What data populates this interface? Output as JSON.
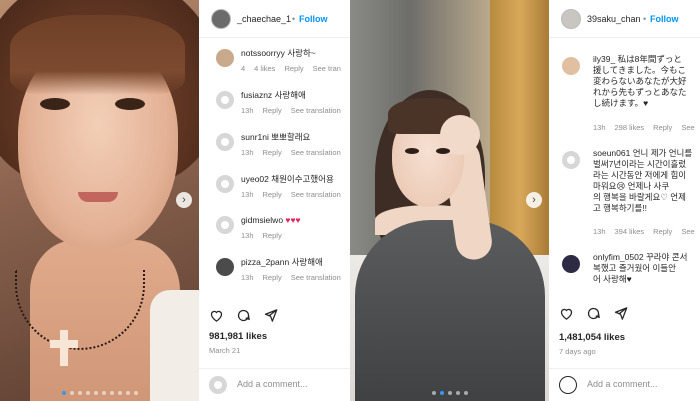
{
  "post1": {
    "header": {
      "username": "_chaechae_1",
      "separator": "•",
      "follow_label": "Follow"
    },
    "comments": [
      {
        "username": "notssoorryy",
        "text": "사랑하~",
        "time": "4",
        "likes": "4 likes",
        "reply": "Reply",
        "translation": "See tran"
      },
      {
        "username": "fusiaznz",
        "text": "사랑해애",
        "time": "13h",
        "reply": "Reply",
        "translation": "See translation"
      },
      {
        "username": "sunr1ni",
        "text": "뽀뽀할래요",
        "time": "13h",
        "reply": "Reply",
        "translation": "See translation"
      },
      {
        "username": "uyeo02",
        "text": "채원이수고했어용",
        "time": "13h",
        "reply": "Reply",
        "translation": "See translation"
      },
      {
        "username": "gidmsielwo",
        "text": "♥♥♥",
        "time": "13h",
        "reply": "Reply"
      },
      {
        "username": "pizza_2pann",
        "text": "사랑해애",
        "time": "13h",
        "reply": "Reply",
        "translation": "See translation"
      }
    ],
    "likes_text": "981,981 likes",
    "date": "March 21",
    "add_comment_placeholder": "Add a comment..."
  },
  "post2": {
    "header": {
      "username": "39saku_chan",
      "separator": "•",
      "follow_label": "Follow"
    },
    "comments": [
      {
        "username": "ily39_",
        "lines": [
          "私は8年間ずっと",
          "援してきました。今もこ",
          "変わらないあなたが大好",
          "れから先もずっとあなた",
          "し続けます。♥"
        ],
        "time": "13h",
        "likes": "298 likes",
        "reply": "Reply",
        "translation": "See"
      },
      {
        "username": "soeun061",
        "lines": [
          "언니 제가 언니를",
          "벌써7년이라는 시간이흘렀",
          "라는 시간동안 저에게 힘이",
          "마워요😢 언제나 사쿠",
          "의 행복을 바랄게요♡ 언제",
          "고 행복하기를!!"
        ],
        "time": "13h",
        "likes": "394 likes",
        "reply": "Reply",
        "translation": "See"
      },
      {
        "username": "onlyfim_0502",
        "lines": [
          "꾸라야 콘서",
          "복했고 즐거웠어 이들안",
          "어 사랑해♥"
        ]
      }
    ],
    "likes_text": "1,481,054 likes",
    "date": "7 days ago",
    "add_comment_placeholder": "Add a comment..."
  },
  "icons": {
    "heart": "heart-icon",
    "comment": "comment-icon",
    "share": "share-icon",
    "bookmark": "bookmark-icon",
    "next": "chevron-right-icon"
  },
  "colors": {
    "follow": "#0095f6",
    "muted": "#8e8e8e",
    "text": "#262626",
    "heart": "#e0245e"
  }
}
